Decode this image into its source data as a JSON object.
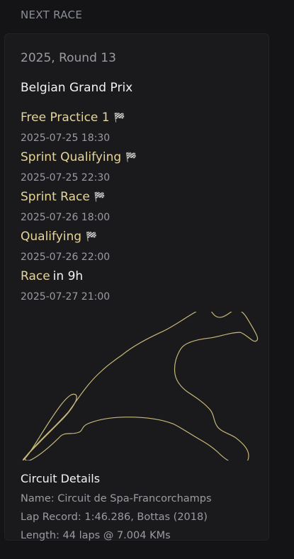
{
  "header": {
    "title": "NEXT RACE"
  },
  "race": {
    "season_round": "2025, Round 13",
    "name": "Belgian Grand Prix"
  },
  "sessions": [
    {
      "name": "Free Practice 1",
      "flag": "🏁",
      "time": "2025-07-25 18:30"
    },
    {
      "name": "Sprint Qualifying",
      "flag": "🏁",
      "time": "2025-07-25 22:30"
    },
    {
      "name": "Sprint Race",
      "flag": "🏁",
      "time": "2025-07-26 18:00"
    },
    {
      "name": "Qualifying",
      "flag": "🏁",
      "time": "2025-07-26 22:00"
    },
    {
      "name": "Race",
      "status": "in 9h",
      "time": "2025-07-27 21:00"
    }
  ],
  "track": {
    "icon": "circuit-map-icon",
    "color": "#c8b97a"
  },
  "circuit": {
    "title": "Circuit Details",
    "name_line": "Name: Circuit de Spa-Francorchamps",
    "lap_record_line": "Lap Record: 1:46.286, Bottas (2018)",
    "length_line": "Length: 44 laps @ 7.004 KMs"
  },
  "colors": {
    "background": "#141416",
    "card": "#1a1a1c",
    "accent": "#e6d59a",
    "muted": "#9a9ca3"
  }
}
